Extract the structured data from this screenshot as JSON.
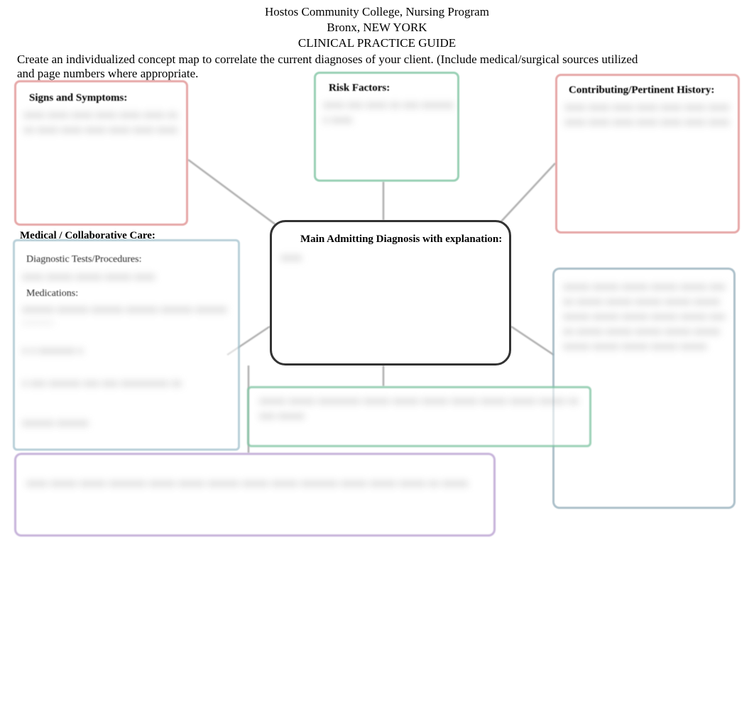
{
  "header": {
    "line1": "Hostos Community College, Nursing Program",
    "line2": "Bronx, NEW YORK",
    "line3": "CLINICAL PRACTICE GUIDE"
  },
  "intro": "Create an individualized concept map to correlate the current diagnoses of your client. (Include medical/surgical sources utilized and page numbers where appropriate.",
  "boxes": {
    "signs": {
      "title": "Signs and Symptoms:",
      "blur": "xxxx xxxx xxxx xxxx xxxx xxxx xxxx xxxx xxxx xxxx xxxx xxxx xxxx"
    },
    "risk": {
      "title": "Risk Factors:",
      "blur": "xxxx xxx xxxx xx xxx xxxxxxx xxxx"
    },
    "history": {
      "title": "Contributing/Pertinent History:",
      "blur": "xxxx xxxx xxxx xxxx xxxx xxxx xxxx xxxx xxxx xxxx xxxx xxxx xxxx xxxx"
    },
    "diagnosis": {
      "title": "Main Admitting Diagnosis with explanation:",
      "blur": "xxxx"
    },
    "medcollab": {
      "title": "Medical / Collaborative Care:",
      "sub1": "Diagnostic Tests/Procedures:",
      "sub2": "Medications:",
      "blur1": "xxxx xxxxx xxxxx xxxxx xxxx",
      "blur2": "xxxxxx xxxxxx xxxxxx xxxxxx xxxxxx xxxxxx xxxxxx",
      "blur3": "x x xxxxxxx x",
      "blur4": "x xxx xxxxxx xxx xxx xxxxxxxxx xx",
      "blur5": "xxxxxx xxxxxx"
    },
    "teach": {
      "blur": "xxxxx xxxxx xxxxx xxxxx xxxxx xxxxx xxxxx xxxxx xxxxx xxxxx xxxxx xxxxx xxxxx xxxxx xxxxx xxxxx xxxxx xxxxx xxxxx xxxxx xxxxx xxxxx xxxxx xxxxx xxxxx xxxxx xxxxx"
    },
    "verde": {
      "blur": "xxxxx xxxxx xxxxxxxx xxxxx xxxxx xxxxx xxxxx xxxxx xxxxx xxxxx xxxxx xxxxx"
    },
    "purple": {
      "blur": "xxxx xxxxx xxxxx xxxxxxx xxxxx xxxxx xxxxxx xxxxx xxxxx xxxxxxx xxxxx xxxxx xxxxx xx xxxxx"
    }
  }
}
